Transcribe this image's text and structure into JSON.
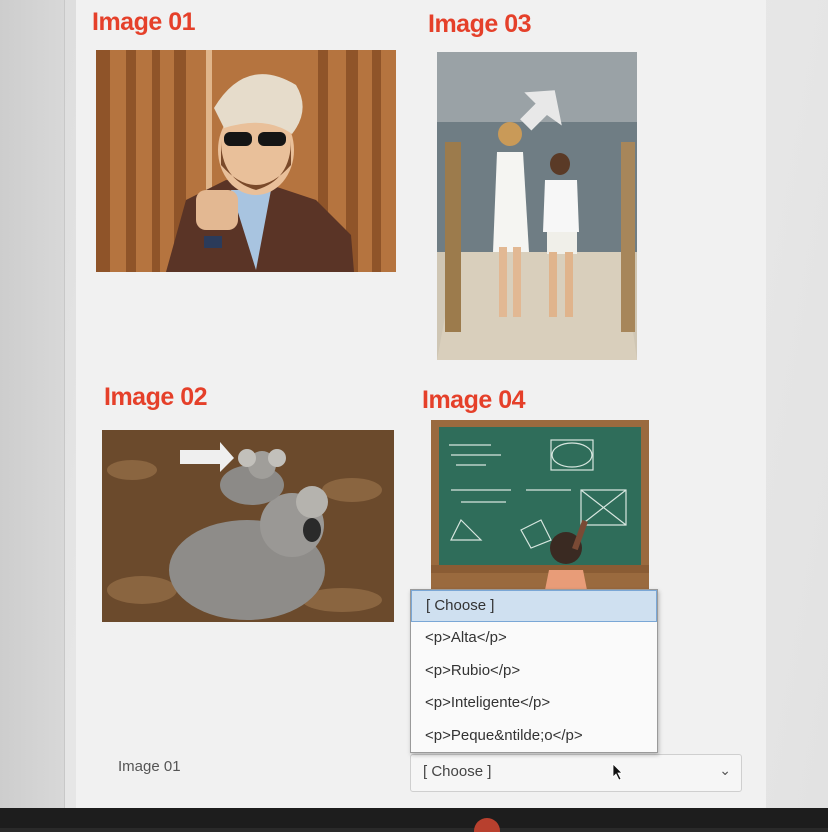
{
  "images": [
    {
      "title": "Image 01",
      "alt": "man with sunglasses and beard"
    },
    {
      "title": "Image 03",
      "alt": "two girls on a pier"
    },
    {
      "title": "Image 02",
      "alt": "koala carrying baby"
    },
    {
      "title": "Image 04",
      "alt": "child at chalkboard"
    }
  ],
  "dropdown": {
    "options": [
      "[ Choose ]",
      "<p>Alta</p>",
      "<p>Rubio</p>",
      "<p>Inteligente</p>",
      "<p>Peque&ntilde;o</p>"
    ],
    "selected_index": 0
  },
  "match_row": {
    "label": "Image 01",
    "select_value": "[ Choose ]"
  },
  "colors": {
    "title": "#e5402a",
    "selected_option": "#cfe0f0"
  }
}
